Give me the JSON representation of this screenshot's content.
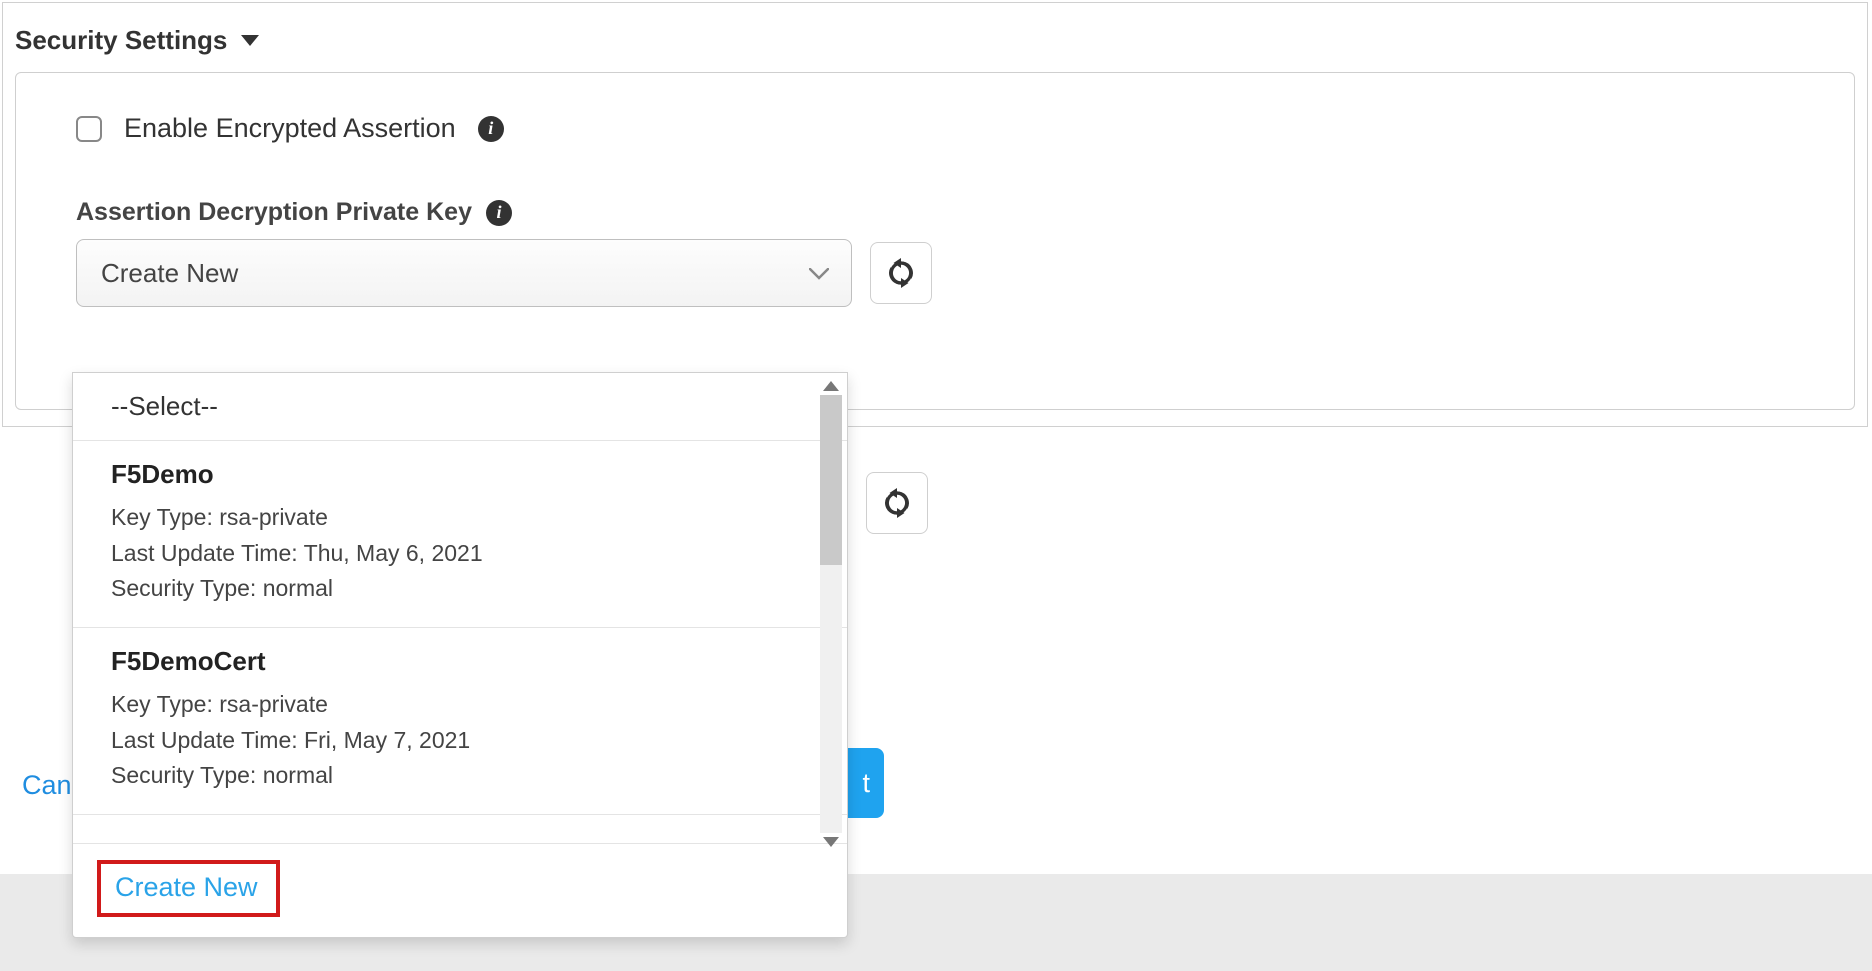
{
  "section": {
    "title": "Security Settings"
  },
  "checkbox": {
    "label": "Enable Encrypted Assertion"
  },
  "field": {
    "label": "Assertion Decryption Private Key",
    "selected": "Create New"
  },
  "dropdown": {
    "placeholder": "--Select--",
    "options": [
      {
        "name": "F5Demo",
        "key_type_label": "Key Type:",
        "key_type": "rsa-private",
        "last_update_label": "Last Update Time:",
        "last_update": "Thu, May 6, 2021",
        "security_type_label": "Security Type:",
        "security_type": "normal"
      },
      {
        "name": "F5DemoCert",
        "key_type_label": "Key Type:",
        "key_type": "rsa-private",
        "last_update_label": "Last Update Time:",
        "last_update": "Fri, May 7, 2021",
        "security_type_label": "Security Type:",
        "security_type": "normal"
      }
    ],
    "create_new": "Create New"
  },
  "buttons": {
    "cancel": "Can",
    "next_fragment": "t"
  }
}
